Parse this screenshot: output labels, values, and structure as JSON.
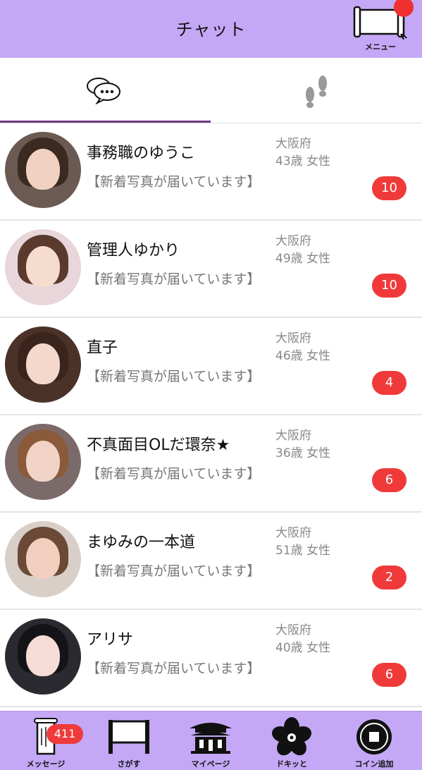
{
  "header": {
    "title": "チャット",
    "menu_label": "メニュー",
    "menu_icon": "scroll-icon"
  },
  "tabs": [
    {
      "name": "chat",
      "icon": "chat-bubbles-icon",
      "active": true
    },
    {
      "name": "footprints",
      "icon": "footprints-icon",
      "active": false
    }
  ],
  "conversations": [
    {
      "name": "事務職のゆうこ",
      "preview": "【新着写真が届いています】",
      "prefecture": "大阪府",
      "age_gender": "43歳 女性",
      "unread": "10"
    },
    {
      "name": "管理人ゆかり",
      "preview": "【新着写真が届いています】",
      "prefecture": "大阪府",
      "age_gender": "49歳 女性",
      "unread": "10"
    },
    {
      "name": "直子",
      "preview": "【新着写真が届いています】",
      "prefecture": "大阪府",
      "age_gender": "46歳 女性",
      "unread": "4"
    },
    {
      "name": "不真面目OLだ環奈★",
      "preview": "【新着写真が届いています】",
      "prefecture": "大阪府",
      "age_gender": "36歳 女性",
      "unread": "6"
    },
    {
      "name": "まゆみの一本道",
      "preview": "【新着写真が届いています】",
      "prefecture": "大阪府",
      "age_gender": "51歳 女性",
      "unread": "2"
    },
    {
      "name": "アリサ",
      "preview": "【新着写真が届いています】",
      "prefecture": "大阪府",
      "age_gender": "40歳 女性",
      "unread": "6"
    }
  ],
  "bottom_nav": [
    {
      "label": "メッセージ",
      "icon": "message-scroll-icon",
      "badge": "411"
    },
    {
      "label": "さがす",
      "icon": "search-board-icon"
    },
    {
      "label": "マイページ",
      "icon": "temple-icon"
    },
    {
      "label": "ドキッと",
      "icon": "sakura-icon"
    },
    {
      "label": "コイン追加",
      "icon": "coin-icon"
    }
  ],
  "colors": {
    "header_bg": "#c4a8f5",
    "tab_underline": "#6a3a82",
    "badge": "#f03a3a"
  }
}
